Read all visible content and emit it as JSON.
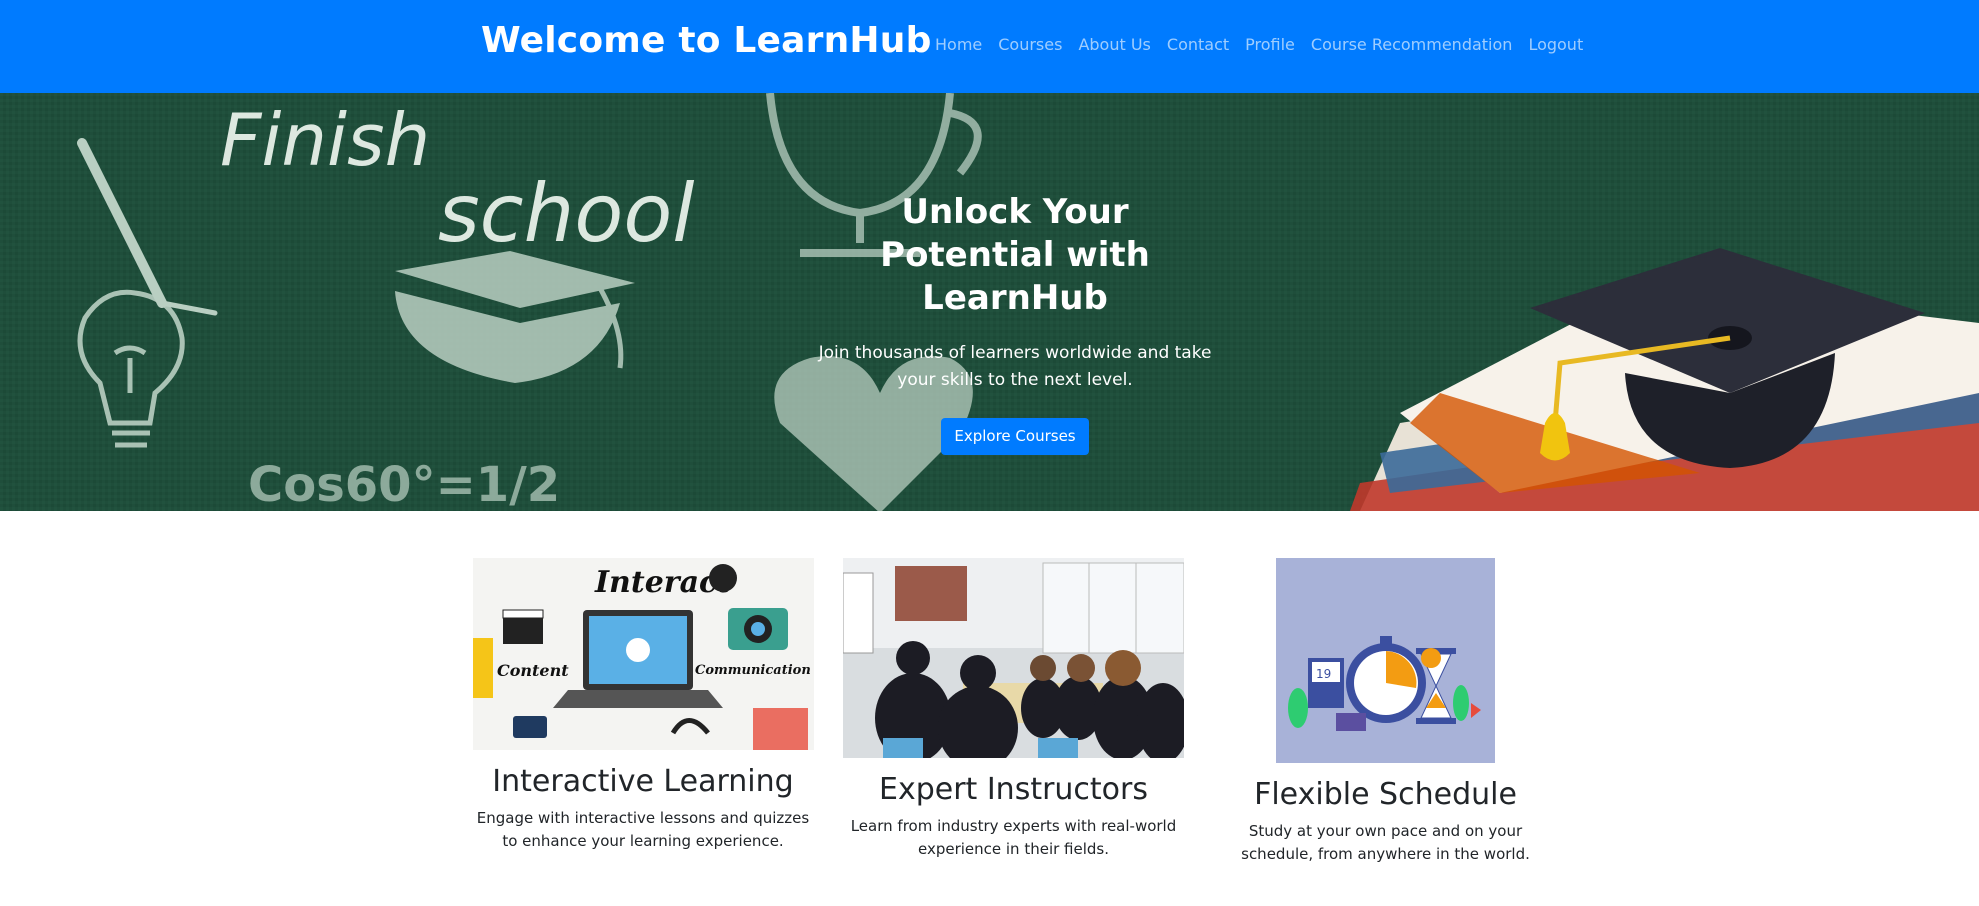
{
  "navbar": {
    "brand": "Welcome to LearnHub",
    "links": [
      "Home",
      "Courses",
      "About Us",
      "Contact",
      "Profile",
      "Course Recommendation",
      "Logout"
    ]
  },
  "hero": {
    "chalk_text_1": "Finish",
    "chalk_text_2": "school",
    "chalk_formula": "Cos60°=1/2",
    "title": "Unlock Your Potential with LearnHub",
    "subtitle": "Join thousands of learners worldwide and take your skills to the next level.",
    "button": "Explore Courses"
  },
  "features": [
    {
      "title": "Interactive Learning",
      "text": "Engage with interactive lessons and quizzes to enhance your learning experience.",
      "image_words": [
        "Interact",
        "Content",
        "Communication"
      ]
    },
    {
      "title": "Expert Instructors",
      "text": "Learn from industry experts with real-world experience in their fields."
    },
    {
      "title": "Flexible Schedule",
      "text": "Study at your own pace and on your schedule, from anywhere in the world.",
      "image_words": [
        "19"
      ]
    }
  ],
  "colors": {
    "primary": "#007bff",
    "chalkboard": "#1e4d3a",
    "schedule_bg": "#a8b2d8"
  }
}
